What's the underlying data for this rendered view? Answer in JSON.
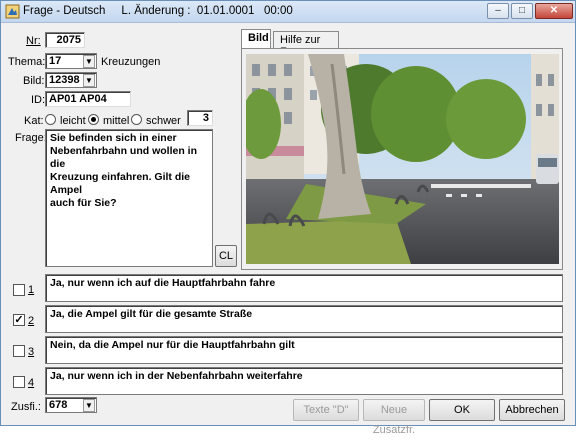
{
  "window": {
    "title": "Frage - Deutsch     L. Änderung :  01.01.0001   00:00",
    "min_label": "–",
    "max_label": "□",
    "close_label": "✕"
  },
  "form": {
    "nr_label": "Nr:",
    "nr_value": "2075",
    "thema_label": "Thema:",
    "thema_value": "17",
    "thema_text": "Kreuzungen",
    "bild_label": "Bild:",
    "bild_value": "12398",
    "id_label": "ID:",
    "id_value": "AP01 AP04",
    "kat_label": "Kat:",
    "kat_options": [
      "leicht",
      "mittel",
      "schwer"
    ],
    "kat_selected": "mittel",
    "kat_value": "3",
    "frage_label": "Frage:",
    "frage_text": "Sie befinden sich in einer\nNebenfahrbahn und wollen in die\nKreuzung einfahren. Gilt die Ampel\nauch für Sie?",
    "cl_label": "CL"
  },
  "tabs": [
    {
      "label": "Bild",
      "active": true
    },
    {
      "label": "Hilfe zur Frage",
      "active": false
    }
  ],
  "answers": [
    {
      "number": "1",
      "checked": false,
      "text": "Ja, nur wenn ich auf die Hauptfahrbahn fahre"
    },
    {
      "number": "2",
      "checked": true,
      "text": "Ja, die Ampel gilt für die gesamte Straße"
    },
    {
      "number": "3",
      "checked": false,
      "text": "Nein, da die Ampel nur für die Hauptfahrbahn gilt"
    },
    {
      "number": "4",
      "checked": false,
      "text": "Ja, nur wenn ich in der Nebenfahrbahn weiterfahre"
    }
  ],
  "footer": {
    "zusf_label": "Zusfi.:",
    "zusf_value": "678",
    "texte_label": "Texte \"D\"",
    "neue_label": "Neue Zusatzfr.",
    "ok_label": "OK",
    "cancel_label": "Abbrechen"
  }
}
